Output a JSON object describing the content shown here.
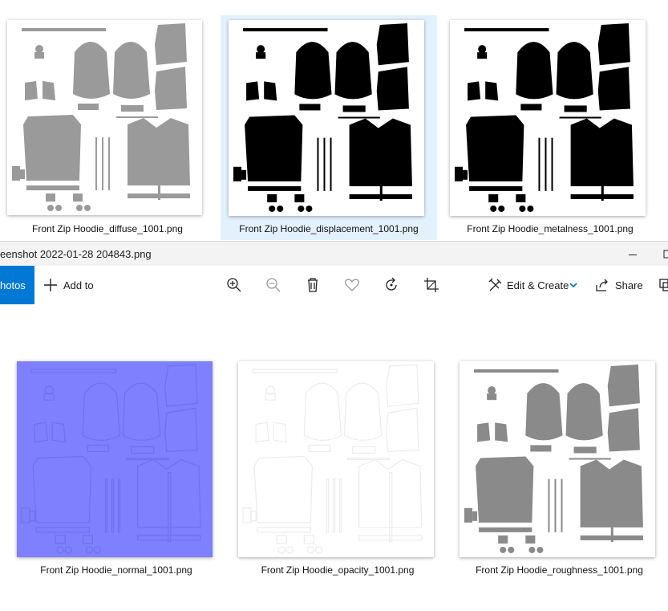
{
  "explorer_top": {
    "files": [
      {
        "name": "Front Zip Hoodie_diffuse_1001.png",
        "icon": "uv-map-gray-thumbnail"
      },
      {
        "name": "Front Zip Hoodie_displacement_1001.png",
        "icon": "uv-map-black-thumbnail",
        "selected": true
      },
      {
        "name": "Front Zip Hoodie_metalness_1001.png",
        "icon": "uv-map-black-thumbnail"
      }
    ],
    "selection_color": "#e3f1fd"
  },
  "photos_app": {
    "title": "eenshot 2022-01-28 204843.png",
    "nav_tab": "hotos",
    "accent": "#0078d4",
    "toolbar": {
      "add_to": "Add to",
      "edit_create": "Edit & Create",
      "share": "Share"
    },
    "files": [
      {
        "name": "Front Zip Hoodie_normal_1001.png",
        "icon": "normal-map-thumbnail",
        "color": "#7e80fe"
      },
      {
        "name": "Front Zip Hoodie_opacity_1001.png",
        "icon": "opacity-map-thumbnail",
        "color": "#ffffff"
      },
      {
        "name": "Front Zip Hoodie_roughness_1001.png",
        "icon": "uv-map-gray-thumbnail",
        "color": "#8a8a8a"
      }
    ]
  }
}
